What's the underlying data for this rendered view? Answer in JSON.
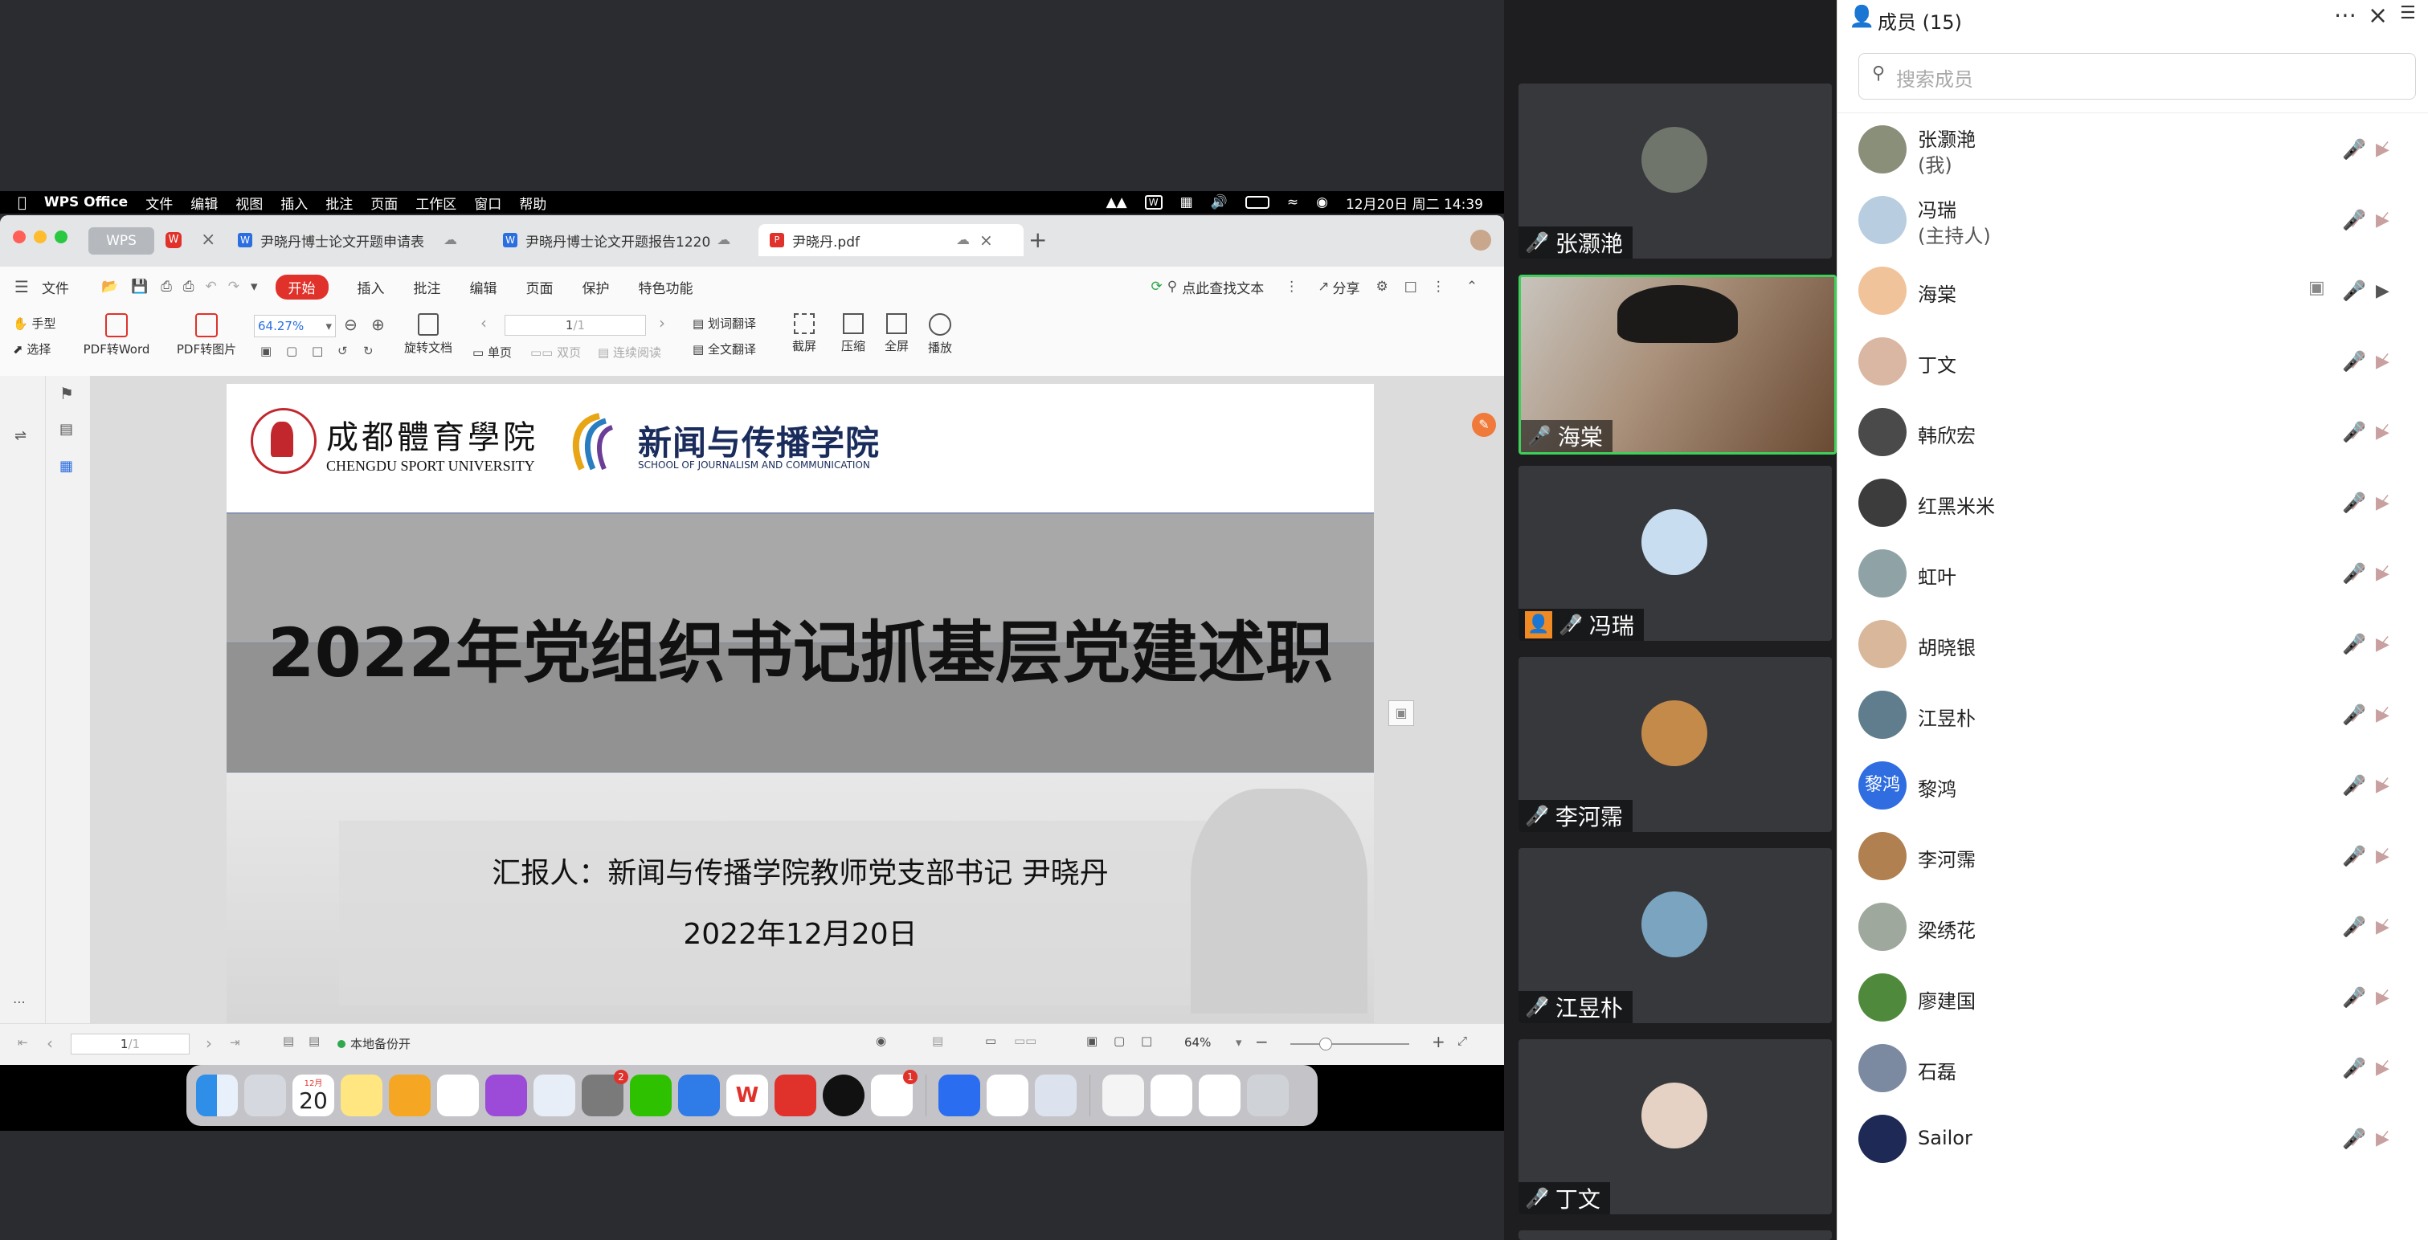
{
  "mac_menubar": {
    "app": "WPS Office",
    "items": [
      "文件",
      "编辑",
      "视图",
      "插入",
      "批注",
      "页面",
      "工作区",
      "窗口",
      "帮助"
    ],
    "clock": "12月20日 周二 14:39"
  },
  "wps": {
    "tabs": {
      "home": "WPS",
      "doc1": "尹晓丹博士论文开题申请表",
      "doc2": "尹晓丹博士论文开题报告1220",
      "doc3": "尹晓丹.pdf"
    },
    "menu": {
      "file": "文件",
      "start": "开始",
      "insert": "插入",
      "annotate": "批注",
      "edit": "编辑",
      "page": "页面",
      "protect": "保护",
      "special": "特色功能",
      "find": "点此查找文本",
      "share": "分享"
    },
    "tools": {
      "hand": "手型",
      "select": "选择",
      "pdf_word": "PDF转Word",
      "pdf_img": "PDF转图片",
      "zoom": "64.27%",
      "rotate": "旋转文档",
      "single": "单页",
      "double": "双页",
      "continuous": "连续阅读",
      "page_no": "1",
      "page_total": "/1",
      "word_translate": "划词翻译",
      "full_translate": "全文翻译",
      "screenshot": "截屏",
      "compress": "压缩",
      "fullscreen": "全屏",
      "play": "播放"
    },
    "slide": {
      "logo1_cn": "成都體育學院",
      "logo1_en": "CHENGDU SPORT UNIVERSITY",
      "logo2_cn": "新闻与传播学院",
      "logo2_en": "SCHOOL OF JOURNALISM AND COMMUNICATION",
      "title": "2022年党组织书记抓基层党建述职",
      "reporter": "汇报人：新闻与传播学院教师党支部书记 尹晓丹",
      "date": "2022年12月20日"
    },
    "status": {
      "page": "1",
      "page_total": "/1",
      "backup": "本地备份开",
      "zoom": "64%"
    }
  },
  "dock": {
    "calendar_month": "12月",
    "calendar_day": "20",
    "badge1": "2",
    "badge2": "1"
  },
  "videos": [
    {
      "name": "张灏滟",
      "muted": true
    },
    {
      "name": "海棠",
      "muted": false
    },
    {
      "name": "冯瑞",
      "muted": true
    },
    {
      "name": "李河霈",
      "muted": true
    },
    {
      "name": "江昱朴",
      "muted": true
    },
    {
      "name": "丁文",
      "muted": true
    }
  ],
  "members": {
    "title": "成员 (15)",
    "search_placeholder": "搜索成员",
    "list": [
      {
        "name": "张灏滟",
        "sub": "(我)",
        "color": "#8a8f7a"
      },
      {
        "name": "冯瑞",
        "sub": "(主持人)",
        "color": "#b9cde0"
      },
      {
        "name": "海棠",
        "sub": "",
        "color": "#f0c39a"
      },
      {
        "name": "丁文",
        "sub": "",
        "color": "#d9b7a2"
      },
      {
        "name": "韩欣宏",
        "sub": "",
        "color": "#4a4a4a"
      },
      {
        "name": "红黑米米",
        "sub": "",
        "color": "#3c3c3c"
      },
      {
        "name": "虹叶",
        "sub": "",
        "color": "#8fa3a6"
      },
      {
        "name": "胡晓银",
        "sub": "",
        "color": "#d8b79a"
      },
      {
        "name": "江昱朴",
        "sub": "",
        "color": "#5f7d8c"
      },
      {
        "name": "黎鸿",
        "sub": "",
        "color": "#2f6de1",
        "initials": "黎鸿"
      },
      {
        "name": "李河霈",
        "sub": "",
        "color": "#b08050"
      },
      {
        "name": "梁绣花",
        "sub": "",
        "color": "#9ea89c"
      },
      {
        "name": "廖建国",
        "sub": "",
        "color": "#4f8a3c"
      },
      {
        "name": "石磊",
        "sub": "",
        "color": "#7b8aa0"
      },
      {
        "name": "Sailor",
        "sub": "",
        "color": "#1e2a55"
      }
    ]
  }
}
